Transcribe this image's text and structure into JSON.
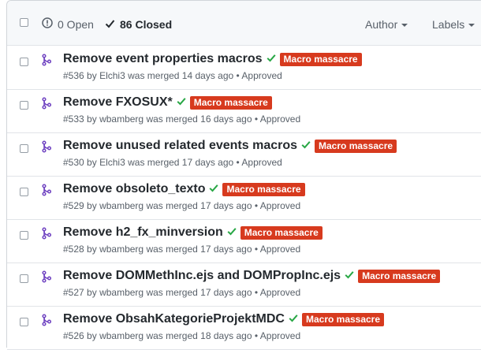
{
  "header": {
    "open_label": "0 Open",
    "closed_label": "86 Closed",
    "author_label": "Author",
    "labels_label": "Labels"
  },
  "colors": {
    "label_bg": "#d73a1e",
    "merged_icon": "#6f42c1",
    "check": "#28a745"
  },
  "pulls": [
    {
      "title": "Remove event properties macros",
      "label": "Macro massacre",
      "number": "#536",
      "by": "by",
      "author": "Elchi3",
      "merged": "was merged 14 days ago",
      "sep": "•",
      "review": "Approved"
    },
    {
      "title": "Remove FXOSUX*",
      "label": "Macro massacre",
      "number": "#533",
      "by": "by",
      "author": "wbamberg",
      "merged": "was merged 16 days ago",
      "sep": "•",
      "review": "Approved"
    },
    {
      "title": "Remove unused related events macros",
      "label": "Macro massacre",
      "number": "#530",
      "by": "by",
      "author": "Elchi3",
      "merged": "was merged 17 days ago",
      "sep": "•",
      "review": "Approved"
    },
    {
      "title": "Remove obsoleto_texto",
      "label": "Macro massacre",
      "number": "#529",
      "by": "by",
      "author": "wbamberg",
      "merged": "was merged 17 days ago",
      "sep": "•",
      "review": "Approved"
    },
    {
      "title": "Remove h2_fx_minversion",
      "label": "Macro massacre",
      "number": "#528",
      "by": "by",
      "author": "wbamberg",
      "merged": "was merged 17 days ago",
      "sep": "•",
      "review": "Approved"
    },
    {
      "title": "Remove DOMMethInc.ejs and DOMPropInc.ejs",
      "label": "Macro massacre",
      "number": "#527",
      "by": "by",
      "author": "wbamberg",
      "merged": "was merged 17 days ago",
      "sep": "•",
      "review": "Approved"
    },
    {
      "title": "Remove ObsahKategorieProjektMDC",
      "label": "Macro massacre",
      "number": "#526",
      "by": "by",
      "author": "wbamberg",
      "merged": "was merged 18 days ago",
      "sep": "•",
      "review": "Approved"
    }
  ]
}
